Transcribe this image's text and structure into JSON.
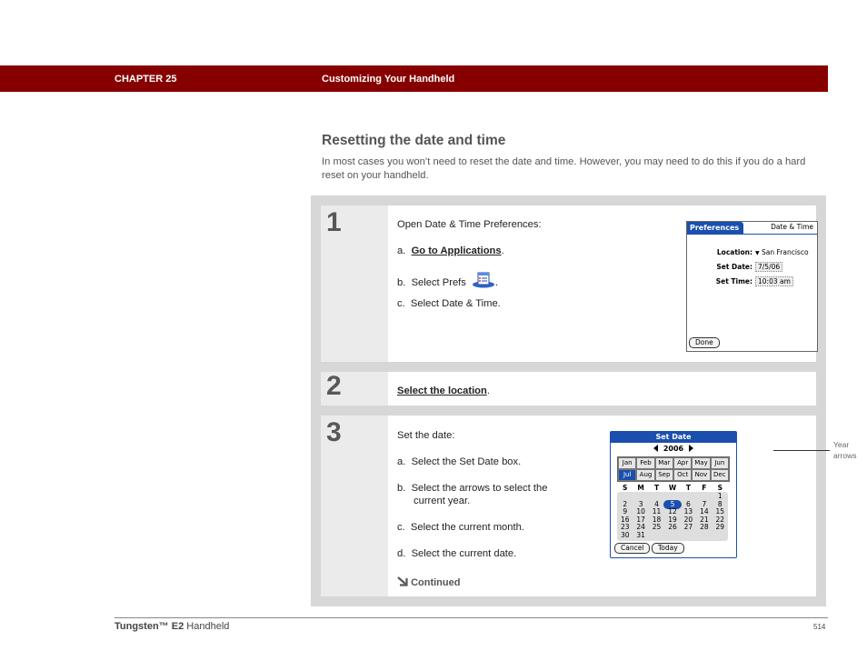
{
  "header": {
    "chapter": "CHAPTER 25",
    "title": "Customizing Your Handheld",
    "bar_color": "#870000"
  },
  "section": {
    "title": "Resetting the date and time",
    "intro": "In most cases you won’t need to reset the date and time. However, you may need to do this if you do a hard reset on your handheld."
  },
  "steps": [
    {
      "number": "1",
      "heading": "Open Date & Time Preferences:",
      "items": [
        {
          "marker": "a.",
          "link": "Go to Applications",
          "suffix": "."
        },
        {
          "marker": "b.",
          "text": "Select Prefs",
          "icon": "prefs-app-icon",
          "suffix": "."
        },
        {
          "marker": "c.",
          "text": "Select Date & Time."
        }
      ],
      "screen": {
        "tab_active": "Preferences",
        "tab_right": "Date & Time",
        "location_label": "Location:",
        "location_value": "San Francisco",
        "set_date_label": "Set Date:",
        "set_date_value": "7/5/06",
        "set_time_label": "Set Time:",
        "set_time_value": "10:03 am",
        "done_button": "Done"
      }
    },
    {
      "number": "2",
      "link": "Select the location",
      "suffix": "."
    },
    {
      "number": "3",
      "heading": "Set the date:",
      "items": [
        {
          "marker": "a.",
          "text": "Select the Set Date box."
        },
        {
          "marker": "b.",
          "text": "Select the arrows to select the",
          "text2": "current year."
        },
        {
          "marker": "c.",
          "text": "Select the current month."
        },
        {
          "marker": "d.",
          "text": "Select the current date."
        }
      ],
      "continued": "Continued",
      "screen": {
        "title": "Set Date",
        "year": "2006",
        "months": [
          "Jan",
          "Feb",
          "Mar",
          "Apr",
          "May",
          "Jun",
          "Jul",
          "Aug",
          "Sep",
          "Oct",
          "Nov",
          "Dec"
        ],
        "selected_month": "Jul",
        "weekdays": [
          "S",
          "M",
          "T",
          "W",
          "T",
          "F",
          "S"
        ],
        "days": [
          "",
          "",
          "",
          "",
          "",
          "",
          "1",
          "2",
          "3",
          "4",
          "5",
          "6",
          "7",
          "8",
          "9",
          "10",
          "11",
          "12",
          "13",
          "14",
          "15",
          "16",
          "17",
          "18",
          "19",
          "20",
          "21",
          "22",
          "23",
          "24",
          "25",
          "26",
          "27",
          "28",
          "29",
          "30",
          "31"
        ],
        "selected_day": "5",
        "cancel_button": "Cancel",
        "today_button": "Today",
        "callout": "Year arrows"
      }
    }
  ],
  "footer": {
    "product": "Tungsten™",
    "model": "E2",
    "suffix": "Handheld",
    "page": "514"
  }
}
